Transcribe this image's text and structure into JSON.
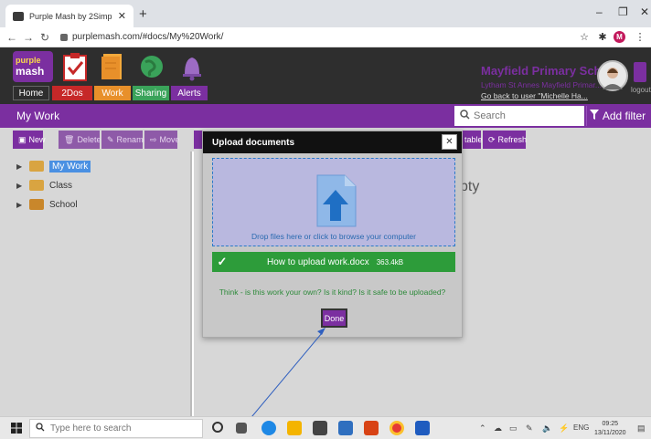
{
  "browser": {
    "tab_title": "Purple Mash by 2Simple",
    "url": "purplemash.com/#docs/My%20Work/",
    "profile_initial": "M"
  },
  "header": {
    "logo_line1": "purple",
    "logo_line2": "mash",
    "nav": [
      "Home",
      "2Dos",
      "Work",
      "Sharing",
      "Alerts"
    ],
    "school_name": "Mayfield Primary School",
    "school_sub": "Lytham St Annes Mayfield Primar...",
    "back_link": "Go back to user \"Michelle Ha...",
    "logout": "logout"
  },
  "titlebar": {
    "title": "My Work",
    "search_placeholder": "Search",
    "filter_label": "Add filter"
  },
  "toolbar": {
    "new": "New",
    "delete": "Delete",
    "rename": "Rename",
    "move": "Move",
    "table": "table",
    "refresh": "Refresh"
  },
  "tree": {
    "items": [
      "My Work",
      "Class",
      "School"
    ]
  },
  "main": {
    "empty_fragment": "pty"
  },
  "modal": {
    "title": "Upload documents",
    "drop_text": "Drop files here or click to browse your computer",
    "file_name": "How to upload work.docx",
    "file_size": "363.4kB",
    "think_text": "Think - is this work your own? Is it kind? Is it safe to be uploaded?",
    "done_label": "Done"
  },
  "taskbar": {
    "search_placeholder": "Type here to search",
    "lang": "ENG",
    "time": "09:25",
    "date": "13/11/2020"
  },
  "colors": {
    "brand_purple": "#7b2fa0",
    "success_green": "#2d9c3a",
    "dark": "#2e2e2e"
  }
}
